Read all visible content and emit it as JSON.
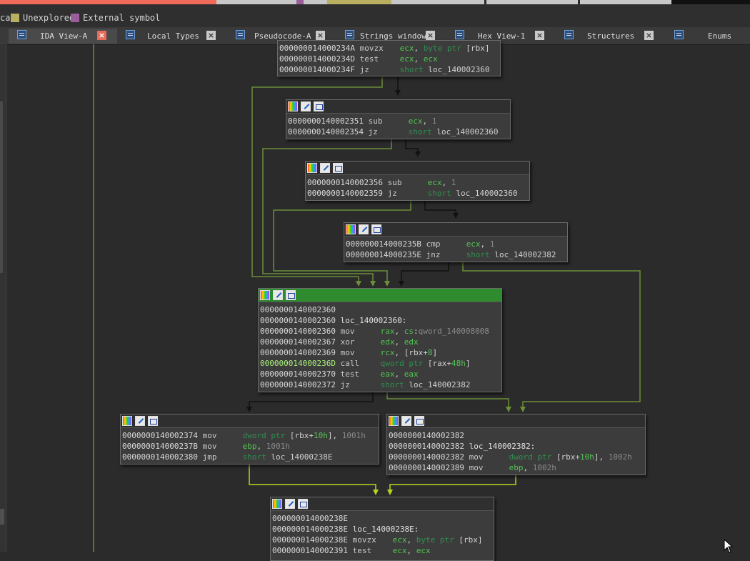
{
  "colors": {
    "background": "#2b2b2b",
    "nav_regular": "#f06a5a",
    "nav_data": "#c8c8c8",
    "nav_unexplored": "#b8b060",
    "nav_external": "#9b5e9b",
    "node_bg": "#3c3c3c",
    "header_highlight": "#2e8b2e",
    "edge_normal": "#6b8e3a",
    "edge_taken": "#8fc03a",
    "edge_black": "#111111",
    "register_green": "#52c452"
  },
  "legend": {
    "items": [
      {
        "label": "ca",
        "color": ""
      },
      {
        "label": "Unexplored",
        "color": "#b8b060"
      },
      {
        "label": "External symbol",
        "color": "#9b5e9b"
      }
    ]
  },
  "tabs": [
    {
      "label": "IDA View-A",
      "icon": "ida-view-icon",
      "active": true
    },
    {
      "label": "Local Types",
      "icon": "local-types-icon",
      "active": false
    },
    {
      "label": "Pseudocode-A",
      "icon": "pseudocode-icon",
      "active": false
    },
    {
      "label": "Strings window",
      "icon": "strings-icon",
      "active": false
    },
    {
      "label": "Hex View-1",
      "icon": "hex-view-icon",
      "active": false
    },
    {
      "label": "Structures",
      "icon": "structures-icon",
      "active": false
    },
    {
      "label": "Enums",
      "icon": "enums-icon",
      "active": false
    }
  ],
  "tab_close_glyph": "×",
  "header_icons": [
    "color-icon",
    "edit-icon",
    "graph-icon"
  ],
  "nodes": [
    {
      "id": "n0",
      "header": false,
      "lines": [
        {
          "addr": "000000014000234A",
          "mnem": "movzx",
          "ops": [
            [
              "reg",
              "ecx"
            ],
            [
              "p",
              ", "
            ],
            [
              "kw",
              "byte ptr "
            ],
            [
              "sym",
              "[rbx]"
            ]
          ]
        },
        {
          "addr": "000000014000234D",
          "mnem": "test",
          "ops": [
            [
              "reg",
              "ecx"
            ],
            [
              "p",
              ", "
            ],
            [
              "reg",
              "ecx"
            ]
          ]
        },
        {
          "addr": "000000014000234F",
          "mnem": "jz",
          "ops": [
            [
              "kw",
              "short "
            ],
            [
              "sym",
              "loc_140002360"
            ]
          ]
        }
      ]
    },
    {
      "id": "n1",
      "header": true,
      "lines": [
        {
          "addr": "0000000140002351",
          "mnem": "sub",
          "ops": [
            [
              "reg",
              "ecx"
            ],
            [
              "p",
              ", "
            ],
            [
              "num",
              "1"
            ]
          ]
        },
        {
          "addr": "0000000140002354",
          "mnem": "jz",
          "ops": [
            [
              "kw",
              "short "
            ],
            [
              "sym",
              "loc_140002360"
            ]
          ]
        }
      ]
    },
    {
      "id": "n2",
      "header": true,
      "lines": [
        {
          "addr": "0000000140002356",
          "mnem": "sub",
          "ops": [
            [
              "reg",
              "ecx"
            ],
            [
              "p",
              ", "
            ],
            [
              "num",
              "1"
            ]
          ]
        },
        {
          "addr": "0000000140002359",
          "mnem": "jz",
          "ops": [
            [
              "kw",
              "short "
            ],
            [
              "sym",
              "loc_140002360"
            ]
          ]
        }
      ]
    },
    {
      "id": "n3",
      "header": true,
      "lines": [
        {
          "addr": "000000014000235B",
          "mnem": "cmp",
          "ops": [
            [
              "reg",
              "ecx"
            ],
            [
              "p",
              ", "
            ],
            [
              "num",
              "1"
            ]
          ]
        },
        {
          "addr": "000000014000235E",
          "mnem": "jnz",
          "ops": [
            [
              "kw",
              "short "
            ],
            [
              "sym",
              "loc_140002382"
            ]
          ]
        }
      ]
    },
    {
      "id": "n4",
      "header": true,
      "highlight": true,
      "lines": [
        {
          "addr": "0000000140002360",
          "mnem": "",
          "ops": []
        },
        {
          "addr": "0000000140002360",
          "label": "loc_140002360:"
        },
        {
          "addr": "0000000140002360",
          "mnem": "mov",
          "ops": [
            [
              "reg",
              "rax"
            ],
            [
              "p",
              ", "
            ],
            [
              "reg",
              "cs"
            ],
            [
              "p",
              ":"
            ],
            [
              "num",
              "qword_140008008"
            ]
          ]
        },
        {
          "addr": "0000000140002367",
          "mnem": "xor",
          "ops": [
            [
              "reg",
              "edx"
            ],
            [
              "p",
              ", "
            ],
            [
              "reg",
              "edx"
            ]
          ]
        },
        {
          "addr": "0000000140002369",
          "mnem": "mov",
          "ops": [
            [
              "reg",
              "rcx"
            ],
            [
              "p",
              ", "
            ],
            [
              "sym",
              "[rbx+"
            ],
            [
              "reg",
              "8"
            ],
            [
              "sym",
              "]"
            ]
          ]
        },
        {
          "addr": "000000014000236D",
          "selected": true,
          "mnem": "call",
          "ops": [
            [
              "kw",
              "qword ptr "
            ],
            [
              "sym",
              "[rax+"
            ],
            [
              "reg",
              "48h"
            ],
            [
              "sym",
              "]"
            ]
          ]
        },
        {
          "addr": "0000000140002370",
          "mnem": "test",
          "ops": [
            [
              "reg",
              "eax"
            ],
            [
              "p",
              ", "
            ],
            [
              "reg",
              "eax"
            ]
          ]
        },
        {
          "addr": "0000000140002372",
          "mnem": "jz",
          "ops": [
            [
              "kw",
              "short "
            ],
            [
              "sym",
              "loc_140002382"
            ]
          ]
        }
      ]
    },
    {
      "id": "n5",
      "header": true,
      "lines": [
        {
          "addr": "0000000140002374",
          "mnem": "mov",
          "ops": [
            [
              "kw",
              "dword ptr "
            ],
            [
              "sym",
              "[rbx+"
            ],
            [
              "reg",
              "10h"
            ],
            [
              "sym",
              "]"
            ],
            [
              "p",
              ", "
            ],
            [
              "num",
              "1001h"
            ]
          ]
        },
        {
          "addr": "000000014000237B",
          "mnem": "mov",
          "ops": [
            [
              "reg",
              "ebp"
            ],
            [
              "p",
              ", "
            ],
            [
              "num",
              "1001h"
            ]
          ]
        },
        {
          "addr": "0000000140002380",
          "mnem": "jmp",
          "ops": [
            [
              "kw",
              "short "
            ],
            [
              "sym",
              "loc_14000238E"
            ]
          ]
        }
      ]
    },
    {
      "id": "n6",
      "header": true,
      "lines": [
        {
          "addr": "0000000140002382",
          "mnem": "",
          "ops": []
        },
        {
          "addr": "0000000140002382",
          "label": "loc_140002382:"
        },
        {
          "addr": "0000000140002382",
          "mnem": "mov",
          "ops": [
            [
              "kw",
              "dword ptr "
            ],
            [
              "sym",
              "[rbx+"
            ],
            [
              "reg",
              "10h"
            ],
            [
              "sym",
              "]"
            ],
            [
              "p",
              ", "
            ],
            [
              "num",
              "1002h"
            ]
          ]
        },
        {
          "addr": "0000000140002389",
          "mnem": "mov",
          "ops": [
            [
              "reg",
              "ebp"
            ],
            [
              "p",
              ", "
            ],
            [
              "num",
              "1002h"
            ]
          ]
        }
      ]
    },
    {
      "id": "n7",
      "header": true,
      "lines": [
        {
          "addr": "000000014000238E",
          "mnem": "",
          "ops": []
        },
        {
          "addr": "000000014000238E",
          "label": "loc_14000238E:"
        },
        {
          "addr": "000000014000238E",
          "mnem": "movzx",
          "ops": [
            [
              "reg",
              "ecx"
            ],
            [
              "p",
              ", "
            ],
            [
              "kw",
              "byte ptr "
            ],
            [
              "sym",
              "[rbx]"
            ]
          ]
        },
        {
          "addr": "0000000140002391",
          "mnem": "test",
          "ops": [
            [
              "reg",
              "ecx"
            ],
            [
              "p",
              ", "
            ],
            [
              "reg",
              "ecx"
            ]
          ]
        }
      ]
    }
  ]
}
